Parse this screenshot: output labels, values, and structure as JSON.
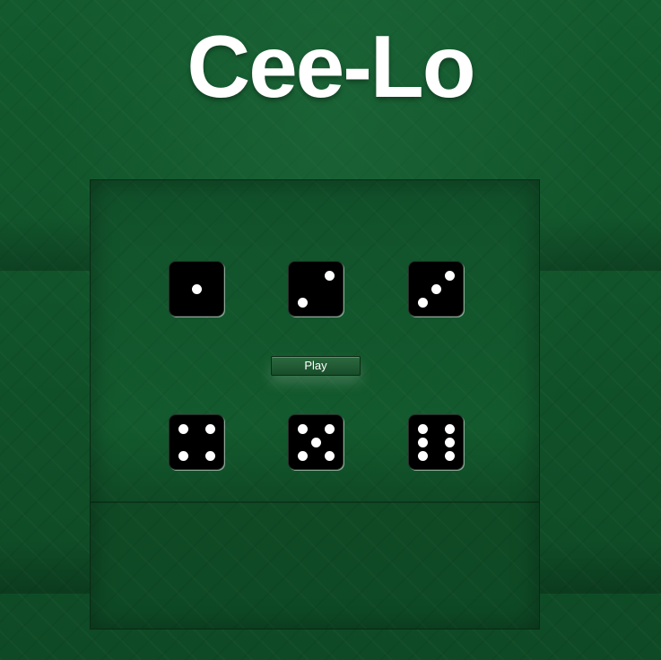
{
  "game": {
    "title": "Cee-Lo",
    "play_label": "Play",
    "dice": [
      {
        "value": 1
      },
      {
        "value": 2
      },
      {
        "value": 3
      },
      {
        "value": 4
      },
      {
        "value": 5
      },
      {
        "value": 6
      }
    ]
  },
  "colors": {
    "felt": "#135a2e",
    "die_face": "#000000",
    "pip": "#ffffff",
    "title": "#ffffff"
  }
}
